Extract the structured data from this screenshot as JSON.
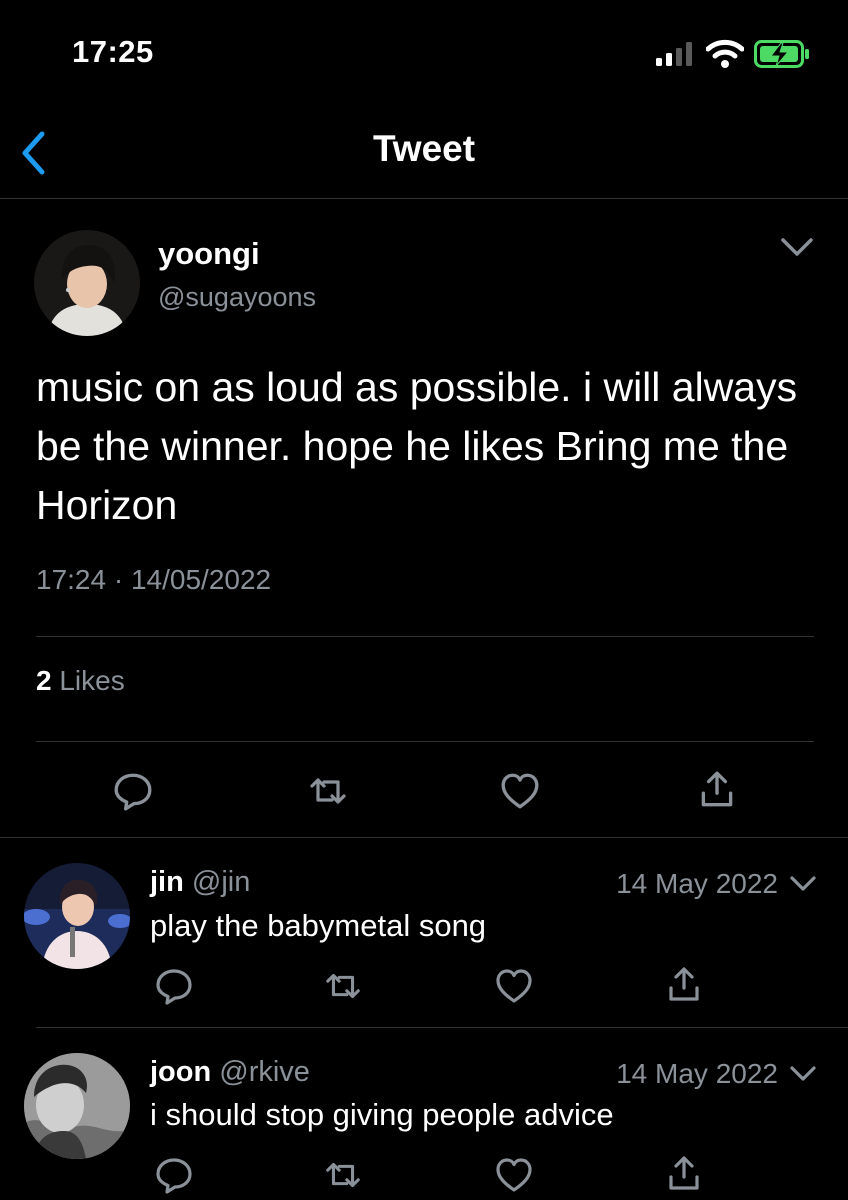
{
  "status_bar": {
    "time": "17:25"
  },
  "nav": {
    "title": "Tweet"
  },
  "tweet": {
    "name": "yoongi",
    "handle": "@sugayoons",
    "text": "music on as loud as possible. i will always be the winner. hope he likes Bring me the Horizon",
    "time": "17:24",
    "separator": "·",
    "date": "14/05/2022",
    "likes_count": "2",
    "likes_label": "Likes"
  },
  "replies": [
    {
      "name": "jin",
      "handle": "@jin",
      "date": "14 May 2022",
      "text": "play the babymetal song"
    },
    {
      "name": "joon",
      "handle": "@rkive",
      "date": "14 May 2022",
      "text": "i should stop giving people advice"
    }
  ],
  "colors": {
    "background": "#000000",
    "text": "#ffffff",
    "secondary": "#8b9198",
    "accent": "#1d9bf0",
    "divider": "#2f3336",
    "battery": "#4cd964"
  },
  "icons": [
    "back-chevron-icon",
    "reply-icon",
    "retweet-icon",
    "like-icon",
    "share-icon",
    "chevron-down-icon"
  ]
}
